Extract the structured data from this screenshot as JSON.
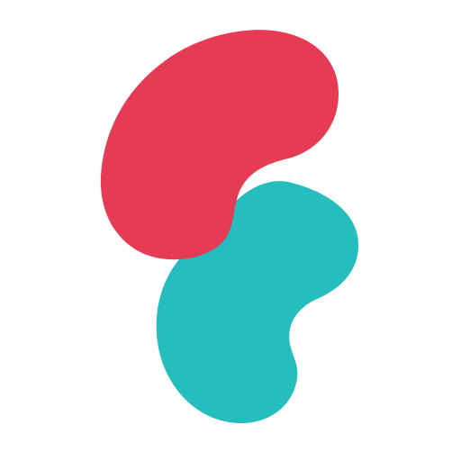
{
  "logo": {
    "icon": "two-bean-shapes-logo",
    "colors": {
      "background": "#ffffff",
      "top_shape": "#E63B54",
      "bottom_shape": "#26BDBE"
    }
  }
}
